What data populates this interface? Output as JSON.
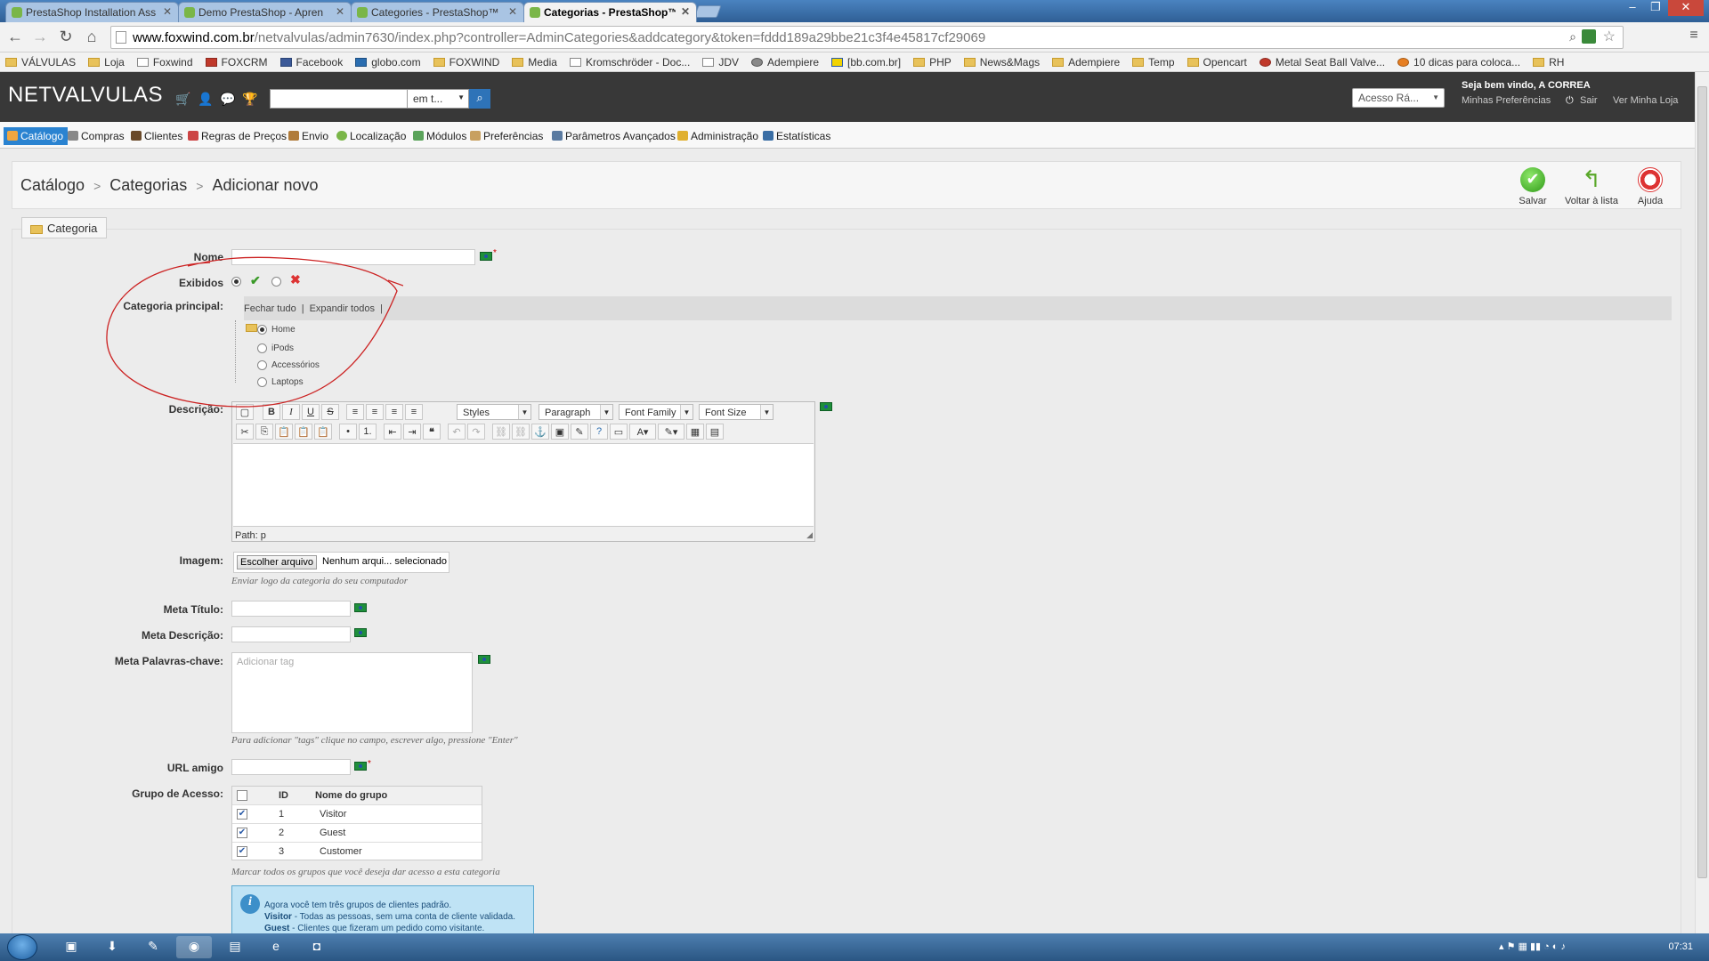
{
  "browser": {
    "tabs": [
      {
        "title": "PrestaShop Installation Ass",
        "active": false
      },
      {
        "title": "Demo PrestaShop - Apren",
        "active": false
      },
      {
        "title": "Categories - PrestaShop™",
        "active": false
      },
      {
        "title": "Categorias - PrestaShop™",
        "active": true
      }
    ],
    "url_host": "www.foxwind.com.br",
    "url_path": "/netvalvulas/admin7630/index.php?controller=AdminCategories&addcategory&token=fddd189a29bbe21c3f4e45817cf29069",
    "bookmarks": [
      "VÁLVULAS",
      "Loja",
      "Foxwind",
      "FOXCRM",
      "Facebook",
      "globo.com",
      "FOXWIND",
      "Media",
      "Kromschröder - Doc...",
      "JDV",
      "Adempiere",
      "[bb.com.br]",
      "PHP",
      "News&Mags",
      "Adempiere",
      "Temp",
      "Opencart",
      "Metal Seat Ball Valve...",
      "10 dicas para coloca...",
      "RH"
    ]
  },
  "header": {
    "logo": "NETVALVULAS",
    "search_scope": "em t...",
    "quick_access": "Acesso Rá...",
    "welcome": "Seja bem vindo, A CORREA",
    "links": {
      "preferences": "Minhas Preferências",
      "logout": "Sair",
      "view_store": "Ver Minha Loja"
    }
  },
  "menu": [
    {
      "label": "Catálogo",
      "active": true,
      "color": "#f0a640"
    },
    {
      "label": "Compras",
      "active": false,
      "color": "#888888"
    },
    {
      "label": "Clientes",
      "active": false,
      "color": "#6a4a2a"
    },
    {
      "label": "Regras de Preços",
      "active": false,
      "color": "#cc4444"
    },
    {
      "label": "Envio",
      "active": false,
      "color": "#b07b3a"
    },
    {
      "label": "Localização",
      "active": false,
      "color": "#7ab648"
    },
    {
      "label": "Módulos",
      "active": false,
      "color": "#5aa35a"
    },
    {
      "label": "Preferências",
      "active": false,
      "color": "#c8a060"
    },
    {
      "label": "Parâmetros Avançados",
      "active": false,
      "color": "#5a7aa0"
    },
    {
      "label": "Administração",
      "active": false,
      "color": "#e0b030"
    },
    {
      "label": "Estatísticas",
      "active": false,
      "color": "#3a6ea5"
    }
  ],
  "breadcrumb": [
    "Catálogo",
    "Categorias",
    "Adicionar novo"
  ],
  "actions": {
    "save": "Salvar",
    "back": "Voltar à lista",
    "help": "Ajuda"
  },
  "form": {
    "legend": "Categoria",
    "name_label": "Nome",
    "displayed_label": "Exibidos",
    "displayed_value": "yes",
    "parent_label": "Categoria principal:",
    "tree_collapse": "Fechar tudo",
    "tree_expand": "Expandir todos",
    "tree": [
      {
        "label": "Home",
        "selected": true
      },
      {
        "label": "iPods",
        "selected": false
      },
      {
        "label": "Accessórios",
        "selected": false
      },
      {
        "label": "Laptops",
        "selected": false
      }
    ],
    "description_label": "Descrição:",
    "editor": {
      "styles": "Styles",
      "format": "Paragraph",
      "font_family": "Font Family",
      "font_size": "Font Size",
      "path": "Path: p"
    },
    "image_label": "Imagem:",
    "file_button": "Escolher arquivo",
    "file_status": "Nenhum arqui... selecionado",
    "image_hint": "Enviar logo da categoria do seu computador",
    "meta_title_label": "Meta Título:",
    "meta_desc_label": "Meta Descrição:",
    "meta_keywords_label": "Meta Palavras-chave:",
    "tags_placeholder": "Adicionar tag",
    "tags_hint": "Para adicionar \"tags\" clique no campo, escrever algo, pressione \"Enter\"",
    "url_label": "URL amigo",
    "groups_label": "Grupo de Acesso:",
    "groups_header": {
      "id": "ID",
      "name": "Nome do grupo"
    },
    "groups": [
      {
        "id": "1",
        "name": "Visitor",
        "checked": true
      },
      {
        "id": "2",
        "name": "Guest",
        "checked": true
      },
      {
        "id": "3",
        "name": "Customer",
        "checked": true
      }
    ],
    "groups_hint": "Marcar todos os grupos que você deseja dar acesso a esta categoria",
    "info": {
      "line1": "Agora você tem três grupos de clientes padrão.",
      "line2_bold": "Visitor",
      "line2": " - Todas as pessoas, sem uma conta de cliente validada.",
      "line3_bold": "Guest",
      "line3": " - Clientes que fizeram um pedido como visitante."
    }
  },
  "annotation_color": "#cc2222",
  "taskbar": {
    "clock": "07:31"
  }
}
